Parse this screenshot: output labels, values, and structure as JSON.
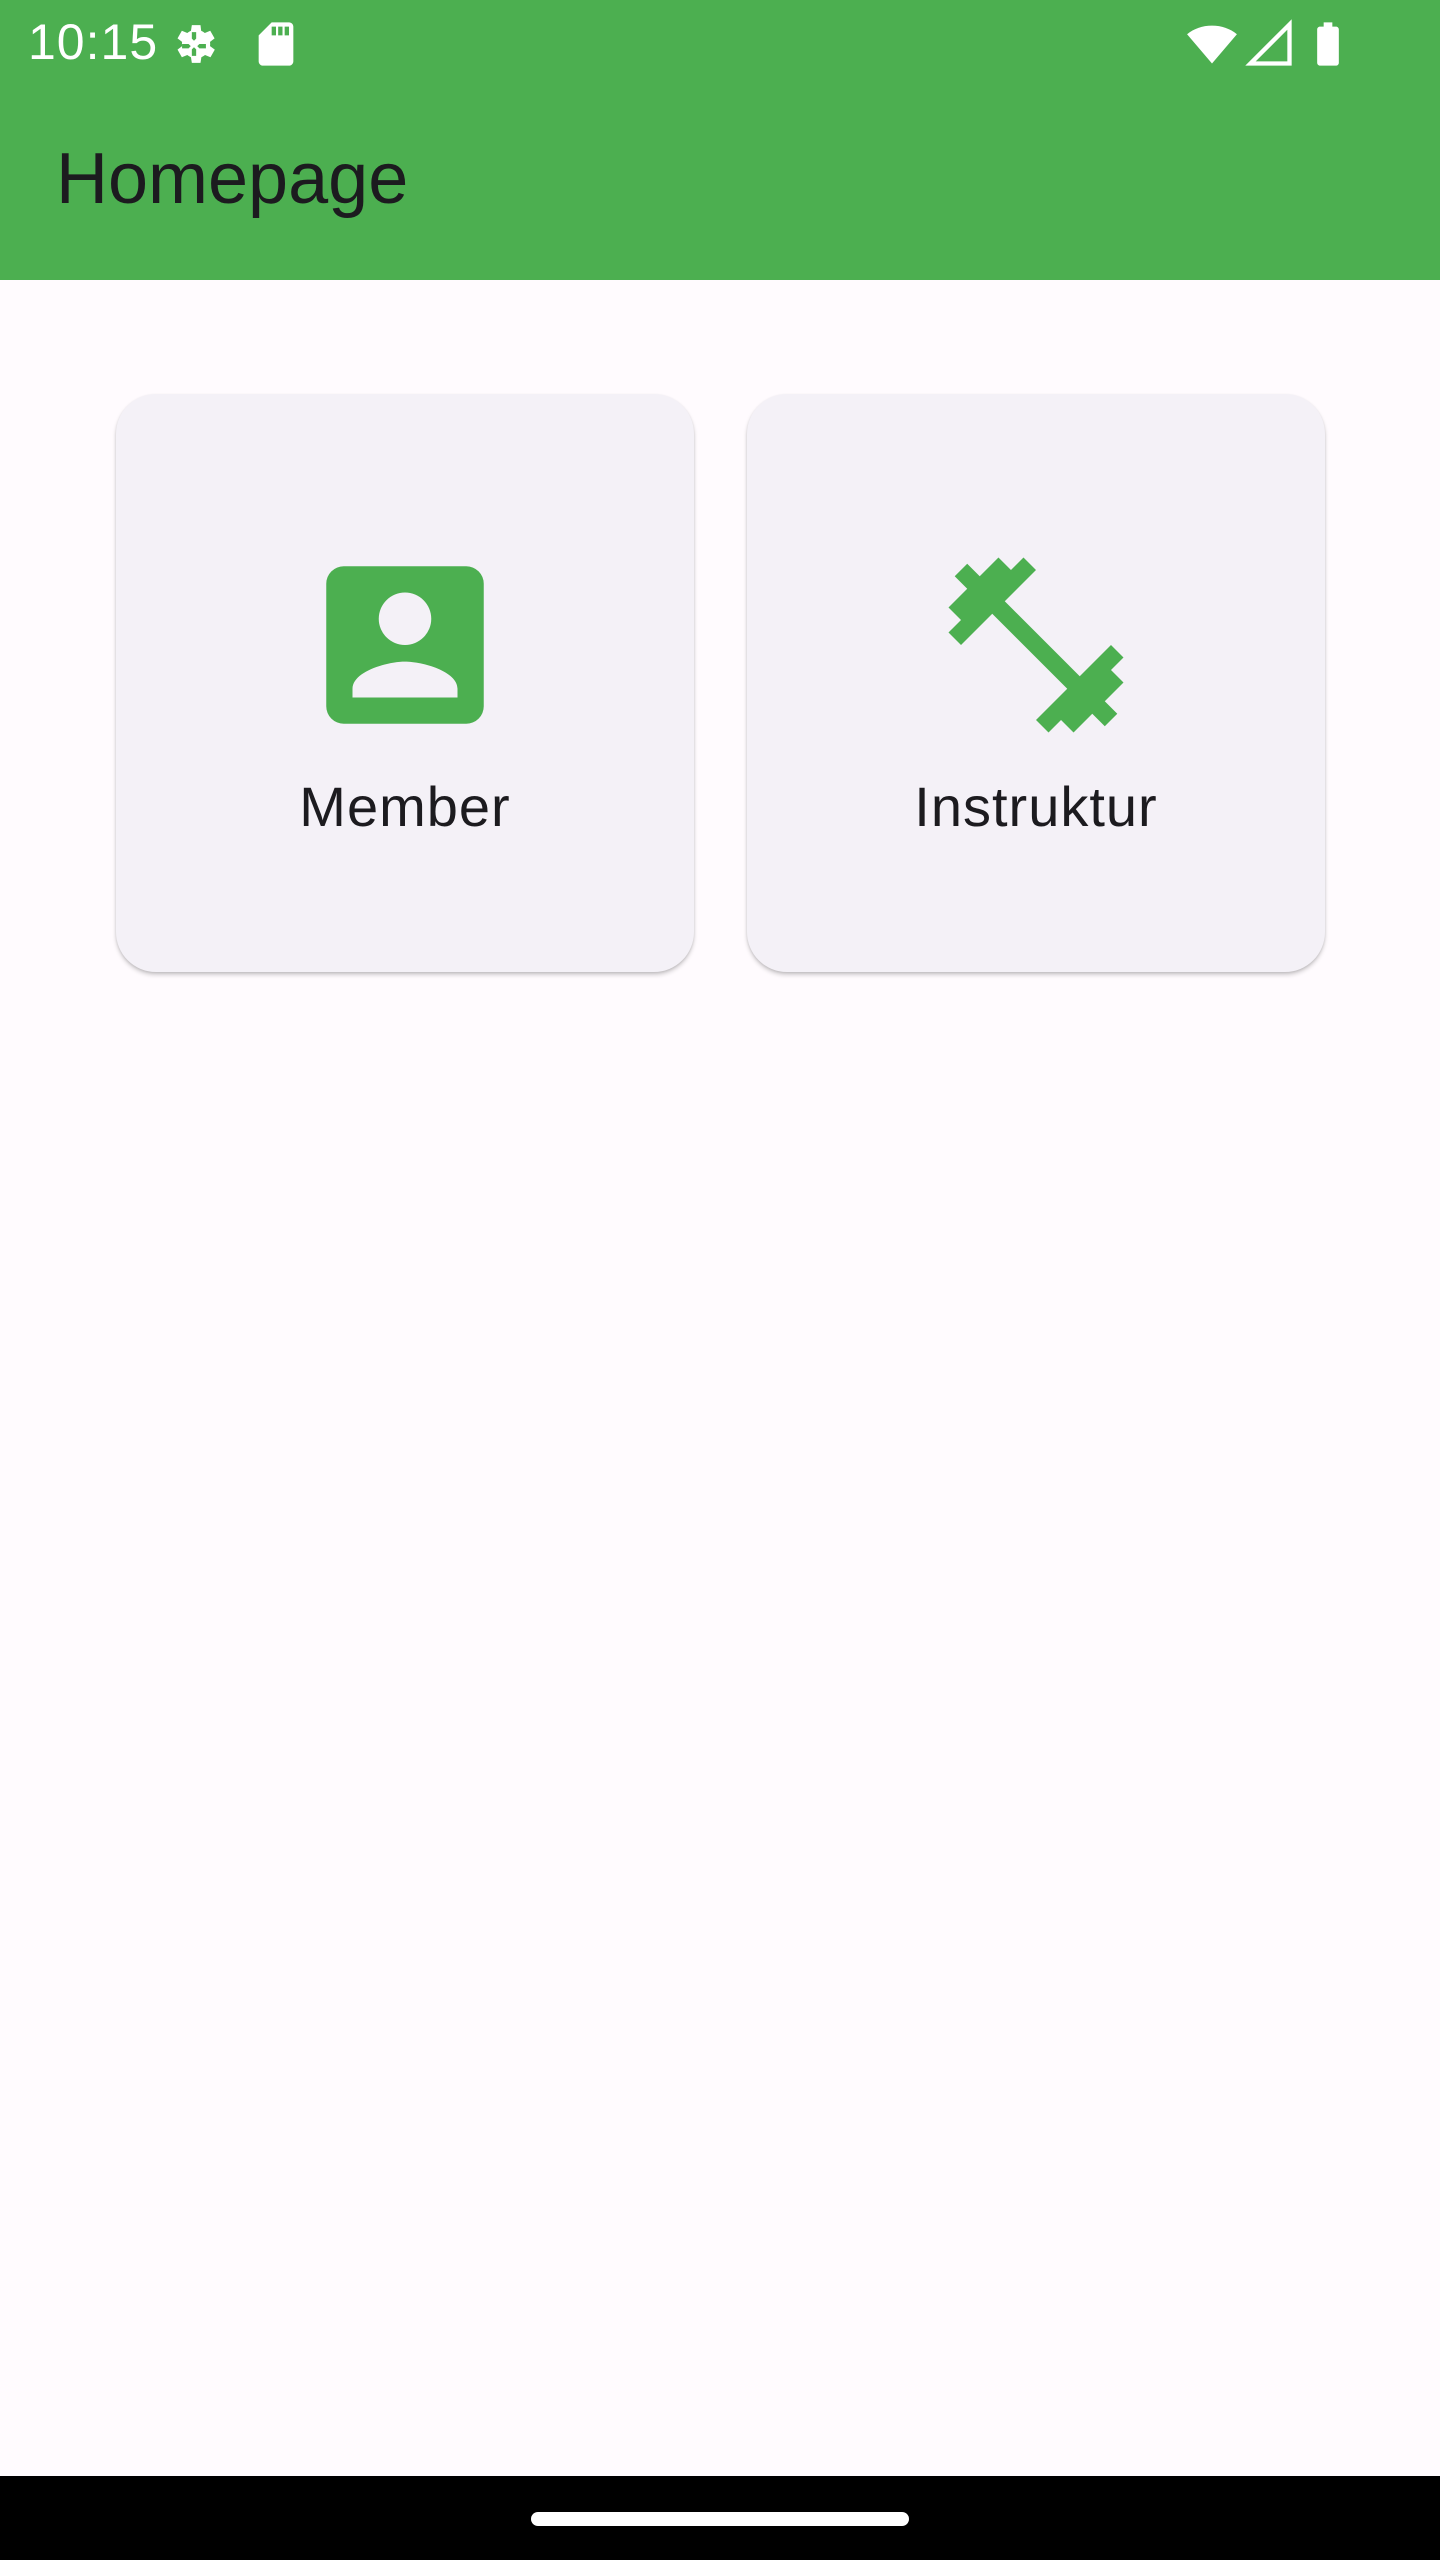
{
  "status_bar": {
    "time": "10:15",
    "icons": [
      "settings-gear-icon",
      "sd-card-icon",
      "wifi-icon",
      "cell-signal-icon",
      "battery-icon"
    ]
  },
  "app_bar": {
    "title": "Homepage"
  },
  "cards": [
    {
      "label": "Member",
      "icon": "account-box-icon"
    },
    {
      "label": "Instruktur",
      "icon": "fitness-dumbbell-icon"
    }
  ],
  "colors": {
    "primary": "#4caf50",
    "background": "#fffbfe",
    "card": "#f4f1f7",
    "text": "#1c1b1f"
  }
}
